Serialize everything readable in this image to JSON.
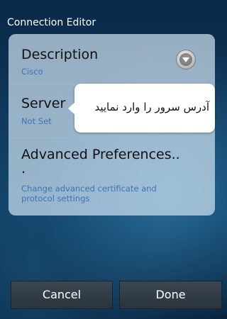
{
  "dialog": {
    "title": "Connection Editor"
  },
  "preferences": [
    {
      "title": "Description",
      "summary": "Cisco",
      "icon": "dropdown-icon"
    },
    {
      "title": "Server",
      "summary": "Not Set"
    },
    {
      "title": "Advanced Preferences..",
      "title_cont": ".",
      "summary": "Change advanced certificate and protocol settings"
    }
  ],
  "tooltip": {
    "text": "آدرس سرور را وارد نمایید"
  },
  "buttons": {
    "cancel": "Cancel",
    "done": "Done"
  }
}
